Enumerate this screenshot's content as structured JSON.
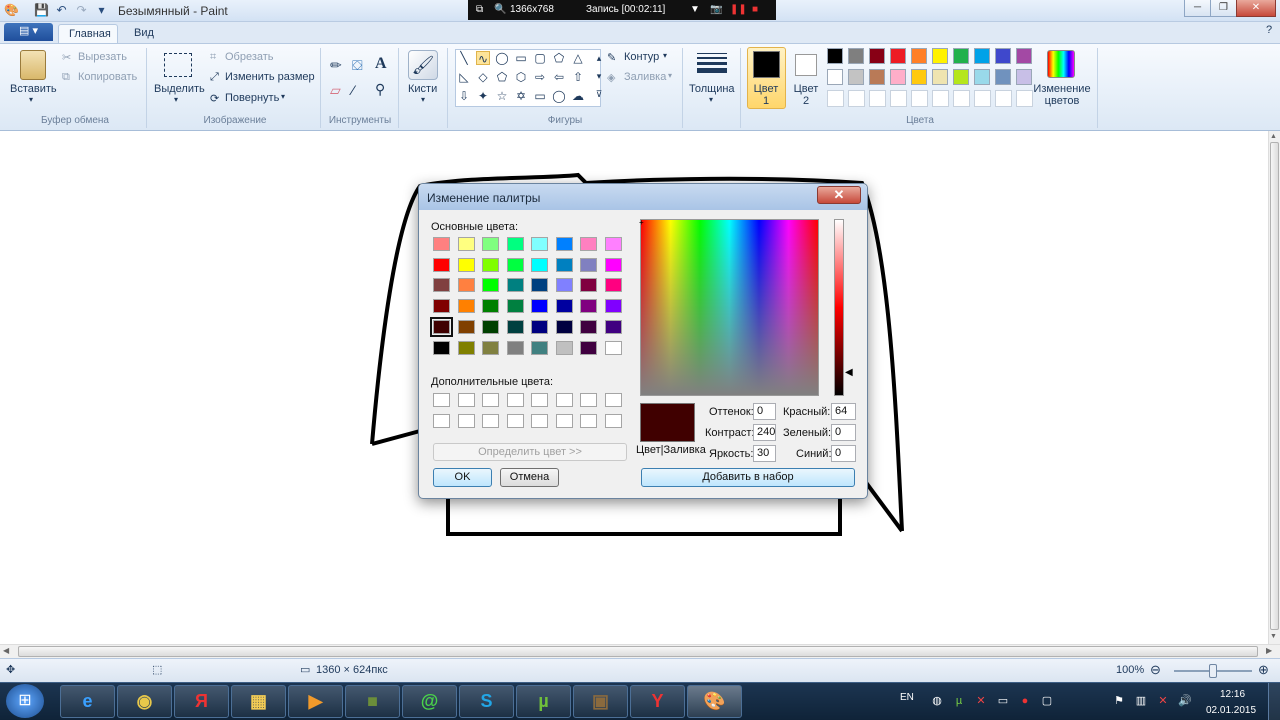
{
  "window": {
    "title": "Безымянный - Paint"
  },
  "recorder": {
    "resolution": "1366x768",
    "status": "Запись [00:02:11]"
  },
  "ribbon": {
    "tabs": [
      {
        "label": "Главная"
      },
      {
        "label": "Вид"
      }
    ],
    "clipboard": {
      "paste": "Вставить",
      "cut": "Вырезать",
      "copy": "Копировать",
      "group": "Буфер обмена"
    },
    "image": {
      "select": "Выделить",
      "crop": "Обрезать",
      "resize": "Изменить размер",
      "rotate": "Повернуть",
      "group": "Изображение"
    },
    "tools": {
      "group": "Инструменты"
    },
    "brushes": {
      "label": "Кисти"
    },
    "shapes": {
      "outline": "Контур",
      "fill": "Заливка",
      "group": "Фигуры"
    },
    "thickness": {
      "label": "Толщина"
    },
    "colors": {
      "color1": "Цвет 1",
      "color2": "Цвет 2",
      "edit": "Изменение цветов",
      "group": "Цвета",
      "color1_value": "#000000",
      "color2_value": "#ffffff",
      "palette_row1": [
        "#000000",
        "#7f7f7f",
        "#880015",
        "#ed1c24",
        "#ff7f27",
        "#fff200",
        "#22b14c",
        "#00a2e8",
        "#3f48cc",
        "#a349a4"
      ],
      "palette_row2": [
        "#ffffff",
        "#c3c3c3",
        "#b97a57",
        "#ffaec9",
        "#ffc90e",
        "#efe4b0",
        "#b5e61d",
        "#99d9ea",
        "#7092be",
        "#c8bfe7"
      ]
    }
  },
  "status": {
    "size": "1360 × 624пкс",
    "zoom": "100%"
  },
  "taskbar": {
    "lang": "EN",
    "time": "12:16",
    "date": "02.01.2015"
  },
  "dialog": {
    "title": "Изменение палитры",
    "basic_label": "Основные цвета:",
    "custom_label": "Дополнительные цвета:",
    "define_button": "Определить цвет >>",
    "ok": "OK",
    "cancel": "Отмена",
    "add_button": "Добавить в набор",
    "preview_label": "Цвет|Заливка",
    "preview_color": "#400000",
    "hue_label": "Оттенок:",
    "hue": "0",
    "sat_label": "Контраст:",
    "sat": "240",
    "lum_label": "Яркость:",
    "lum": "30",
    "red_label": "Красный:",
    "red": "64",
    "green_label": "Зеленый:",
    "green": "0",
    "blue_label": "Синий:",
    "blue": "0",
    "selected_index": 32,
    "basic_colors": [
      "#ff8080",
      "#ffff80",
      "#80ff80",
      "#00ff80",
      "#80ffff",
      "#0080ff",
      "#ff80c0",
      "#ff80ff",
      "#ff0000",
      "#ffff00",
      "#80ff00",
      "#00ff40",
      "#00ffff",
      "#0080c0",
      "#8080c0",
      "#ff00ff",
      "#804040",
      "#ff8040",
      "#00ff00",
      "#008080",
      "#004080",
      "#8080ff",
      "#800040",
      "#ff0080",
      "#800000",
      "#ff8000",
      "#008000",
      "#008040",
      "#0000ff",
      "#0000a0",
      "#800080",
      "#8000ff",
      "#400000",
      "#804000",
      "#004000",
      "#004040",
      "#000080",
      "#000040",
      "#400040",
      "#400080",
      "#000000",
      "#808000",
      "#808040",
      "#808080",
      "#408080",
      "#c0c0c0",
      "#400040",
      "#ffffff"
    ]
  }
}
